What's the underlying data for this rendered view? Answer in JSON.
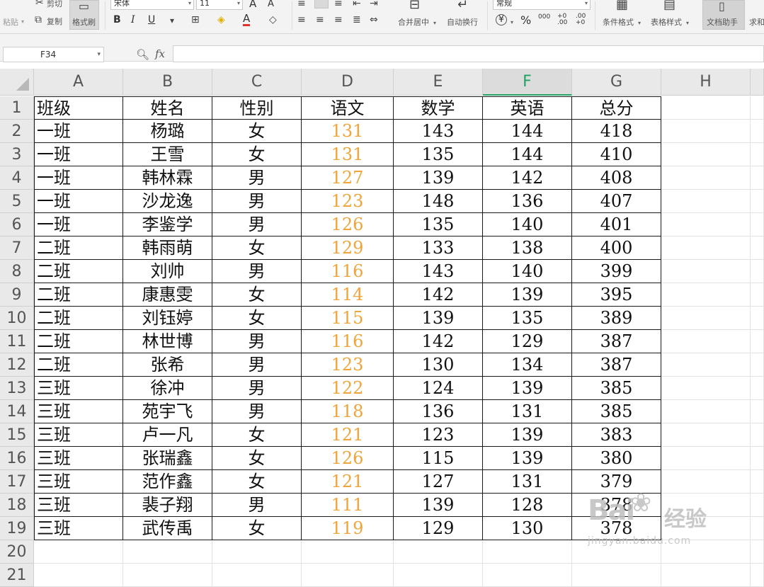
{
  "ribbon": {
    "cut": "剪切",
    "paste": "粘贴",
    "copy": "复制",
    "format_painter": "格式刷",
    "font_name": "宋体",
    "font_size": "11",
    "bold": "B",
    "italic": "I",
    "underline": "U",
    "grow_font": "A",
    "shrink_font": "A",
    "font_color": "A",
    "merge_center": "合并居中",
    "wrap_text": "自动换行",
    "number_format": "常规",
    "currency": "¥",
    "percent": "%",
    "thousands": "000",
    "inc_decimal": "+0 .00",
    "dec_decimal": ".00 +0",
    "conditional_format": "条件格式",
    "table_style": "表格样式",
    "doc_assistant": "文档助手",
    "more": "求和"
  },
  "formula_bar": {
    "name_box": "F34",
    "fx": "fx",
    "formula": ""
  },
  "columns": [
    "A",
    "B",
    "C",
    "D",
    "E",
    "F",
    "G",
    "H"
  ],
  "rows": [
    "1",
    "2",
    "3",
    "4",
    "5",
    "6",
    "7",
    "8",
    "9",
    "10",
    "11",
    "12",
    "13",
    "14",
    "15",
    "16",
    "17",
    "18",
    "19",
    "20",
    "21"
  ],
  "selected_column": "F",
  "colors": {
    "chinese_score": "#f0a43a",
    "header_text": "#555555",
    "active_col": "#21a366"
  },
  "table": {
    "headers": [
      "班级",
      "姓名",
      "性别",
      "语文",
      "数学",
      "英语",
      "总分"
    ],
    "rows": [
      [
        "一班",
        "杨璐",
        "女",
        "131",
        "143",
        "144",
        "418"
      ],
      [
        "一班",
        "王雪",
        "女",
        "131",
        "135",
        "144",
        "410"
      ],
      [
        "一班",
        "韩林霖",
        "男",
        "127",
        "139",
        "142",
        "408"
      ],
      [
        "一班",
        "沙龙逸",
        "男",
        "123",
        "148",
        "136",
        "407"
      ],
      [
        "一班",
        "李鉴学",
        "男",
        "126",
        "135",
        "140",
        "401"
      ],
      [
        "二班",
        "韩雨萌",
        "女",
        "129",
        "133",
        "138",
        "400"
      ],
      [
        "二班",
        "刘帅",
        "男",
        "116",
        "143",
        "140",
        "399"
      ],
      [
        "二班",
        "康惠雯",
        "女",
        "114",
        "142",
        "139",
        "395"
      ],
      [
        "二班",
        "刘钰婷",
        "女",
        "115",
        "139",
        "135",
        "389"
      ],
      [
        "二班",
        "林世博",
        "男",
        "116",
        "142",
        "129",
        "387"
      ],
      [
        "二班",
        "张希",
        "男",
        "123",
        "130",
        "134",
        "387"
      ],
      [
        "三班",
        "徐冲",
        "男",
        "122",
        "124",
        "139",
        "385"
      ],
      [
        "三班",
        "苑宇飞",
        "男",
        "118",
        "136",
        "131",
        "385"
      ],
      [
        "三班",
        "卢一凡",
        "女",
        "121",
        "123",
        "139",
        "383"
      ],
      [
        "三班",
        "张瑞鑫",
        "女",
        "126",
        "115",
        "139",
        "380"
      ],
      [
        "三班",
        "范作鑫",
        "女",
        "121",
        "127",
        "131",
        "379"
      ],
      [
        "三班",
        "裴子翔",
        "男",
        "111",
        "139",
        "128",
        "378"
      ],
      [
        "三班",
        "武传禹",
        "女",
        "119",
        "129",
        "130",
        "378"
      ]
    ]
  },
  "watermark": {
    "logo": "Bai",
    "text": "经验",
    "url": "jingyan.baidu.com"
  }
}
